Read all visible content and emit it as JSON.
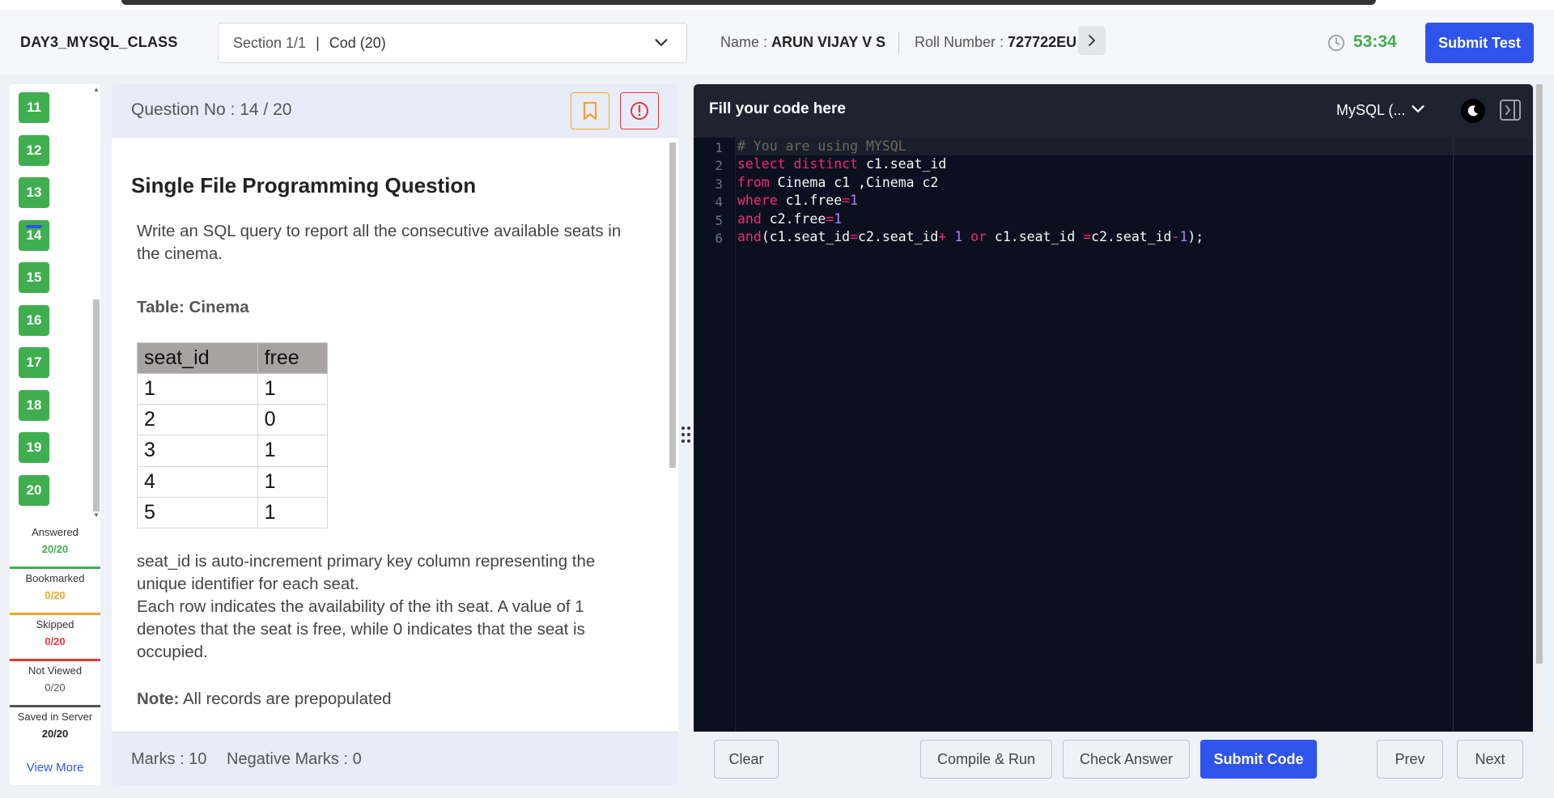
{
  "header": {
    "test_name": "DAY3_MYSQL_CLASS",
    "section_label": "Section 1/1",
    "section_separator": "|",
    "section_value": "Cod (20)",
    "name_label": "Name :",
    "name_value": "ARUN VIJAY V S",
    "roll_label": "Roll Number :",
    "roll_value": "727722EU",
    "timer": "53:34",
    "submit_test_label": "Submit Test",
    "accent_color": "#2f54eb",
    "timer_color": "#3fae4f"
  },
  "question_nav": {
    "items": [
      {
        "number": "11"
      },
      {
        "number": "12"
      },
      {
        "number": "13"
      },
      {
        "number": "14"
      },
      {
        "number": "15"
      },
      {
        "number": "16"
      },
      {
        "number": "17"
      },
      {
        "number": "18"
      },
      {
        "number": "19"
      },
      {
        "number": "20"
      }
    ],
    "current": "14",
    "stats": [
      {
        "label": "Answered",
        "value": "20/20",
        "color": "#3fae4f"
      },
      {
        "label": "Bookmarked",
        "value": "0/20",
        "color": "#f5a623"
      },
      {
        "label": "Skipped",
        "value": "0/20",
        "color": "#e53935"
      },
      {
        "label": "Not Viewed",
        "value": "0/20",
        "color": "#555555"
      },
      {
        "label": "Saved in Server",
        "value": "20/20",
        "color": "#333333"
      }
    ],
    "view_more_label": "View More"
  },
  "question": {
    "number_label": "Question No : 14 / 20",
    "title": "Single File Programming Question",
    "intro": "Write an SQL query to report all the consecutive available seats in the cinema.",
    "table_caption": "Table: Cinema",
    "table": {
      "headers": [
        "seat_id",
        "free"
      ],
      "rows": [
        [
          "1",
          "1"
        ],
        [
          "2",
          "0"
        ],
        [
          "3",
          "1"
        ],
        [
          "4",
          "1"
        ],
        [
          "5",
          "1"
        ]
      ]
    },
    "desc1": "seat_id is auto-increment primary key column representing the unique identifier for each seat.",
    "desc2": "Each row indicates the availability of the ith seat. A value of 1 denotes that the seat is free, while 0 indicates that the seat is occupied.",
    "note_label": "Note:",
    "note_text": "All records are prepopulated",
    "marks_label": "Marks : 10",
    "negative_marks_label": "Negative Marks : 0"
  },
  "editor": {
    "title": "Fill your code here",
    "language": "MySQL (...",
    "line_numbers": [
      "1",
      "2",
      "3",
      "4",
      "5",
      "6"
    ],
    "code_lines": [
      "# You are using MYSQL",
      "select distinct c1.seat_id",
      "from Cinema c1 ,Cinema c2",
      "where c1.free=1",
      "and c2.free=1",
      "and(c1.seat_id=c2.seat_id+ 1 or c1.seat_id =c2.seat_id-1);"
    ]
  },
  "actions": {
    "clear": "Clear",
    "compile_run": "Compile & Run",
    "check_answer": "Check Answer",
    "submit_code": "Submit Code",
    "prev": "Prev",
    "next": "Next"
  }
}
